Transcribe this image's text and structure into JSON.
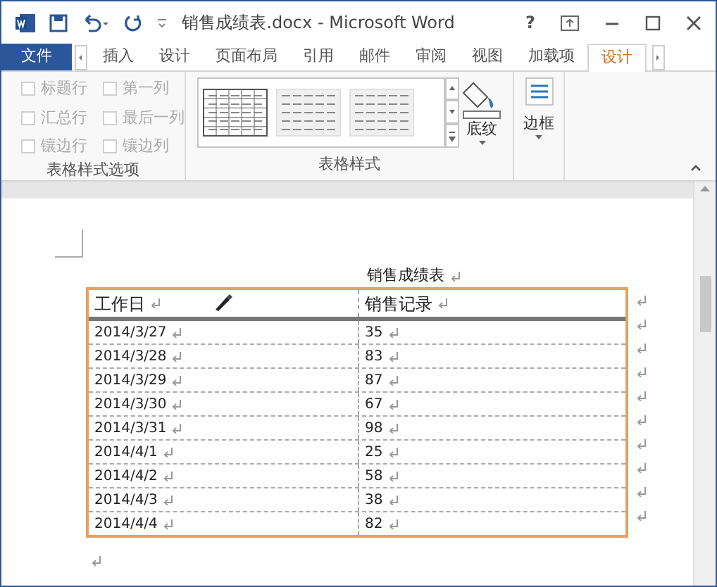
{
  "window": {
    "title": "销售成绩表.docx - Microsoft Word",
    "help": "?"
  },
  "tabs": [
    {
      "label": "文件",
      "kind": "file",
      "selected": false
    },
    {
      "label": "插入",
      "kind": "tab",
      "selected": false
    },
    {
      "label": "设计",
      "kind": "tab",
      "selected": false
    },
    {
      "label": "页面布局",
      "kind": "tab",
      "selected": false
    },
    {
      "label": "引用",
      "kind": "tab",
      "selected": false
    },
    {
      "label": "邮件",
      "kind": "tab",
      "selected": false
    },
    {
      "label": "审阅",
      "kind": "tab",
      "selected": false
    },
    {
      "label": "视图",
      "kind": "tab",
      "selected": false
    },
    {
      "label": "加载项",
      "kind": "tab",
      "selected": false
    },
    {
      "label": "设计",
      "kind": "tab",
      "selected": true
    }
  ],
  "ribbon": {
    "style_options": {
      "label": "表格样式选项",
      "checkboxes": [
        {
          "label": "标题行",
          "checked": false,
          "disabled": true
        },
        {
          "label": "第一列",
          "checked": false,
          "disabled": true
        },
        {
          "label": "汇总行",
          "checked": false,
          "disabled": true
        },
        {
          "label": "最后一列",
          "checked": false,
          "disabled": true
        },
        {
          "label": "镶边行",
          "checked": false,
          "disabled": true
        },
        {
          "label": "镶边列",
          "checked": false,
          "disabled": true
        }
      ]
    },
    "table_styles": {
      "label": "表格样式",
      "shading": "底纹"
    },
    "borders": {
      "label": "边框"
    }
  },
  "document": {
    "title": "销售成绩表",
    "table": {
      "columns": [
        "工作日",
        "销售记录"
      ],
      "rows": [
        [
          "2014/3/27",
          "35"
        ],
        [
          "2014/3/28",
          "83"
        ],
        [
          "2014/3/29",
          "87"
        ],
        [
          "2014/3/30",
          "67"
        ],
        [
          "2014/3/31",
          "98"
        ],
        [
          "2014/4/1",
          "25"
        ],
        [
          "2014/4/2",
          "58"
        ],
        [
          "2014/4/3",
          "38"
        ],
        [
          "2014/4/4",
          "82"
        ]
      ]
    }
  }
}
